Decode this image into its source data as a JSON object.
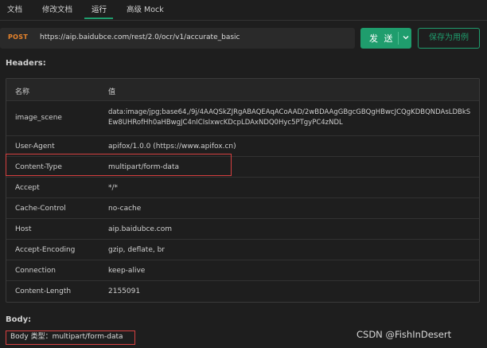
{
  "tabs": [
    {
      "label": "文档"
    },
    {
      "label": "修改文档"
    },
    {
      "label": "运行"
    },
    {
      "label": "高级 Mock"
    }
  ],
  "request": {
    "method": "POST",
    "url": "https://aip.baidubce.com/rest/2.0/ocr/v1/accurate_basic",
    "send_label": "发 送",
    "save_label": "保存为用例"
  },
  "headers": {
    "title": "Headers:",
    "col_name": "名称",
    "col_value": "值",
    "rows": [
      {
        "name": "image_scene",
        "value": "data:image/jpg;base64,/9j/4AAQSkZJRgABAQEAqACoAAD/2wBDAAgGBgcGBQgHBwcJCQgKDBQNDAsLDBkSEw8UHRofHh0aHBwgJC4nICIsIxwcKDcpLDAxNDQ0Hyc5PTgyPC4zNDL"
      },
      {
        "name": "User-Agent",
        "value": "apifox/1.0.0 (https://www.apifox.cn)"
      },
      {
        "name": "Content-Type",
        "value": "multipart/form-data"
      },
      {
        "name": "Accept",
        "value": "*/*"
      },
      {
        "name": "Cache-Control",
        "value": "no-cache"
      },
      {
        "name": "Host",
        "value": "aip.baidubce.com"
      },
      {
        "name": "Accept-Encoding",
        "value": "gzip, deflate, br"
      },
      {
        "name": "Connection",
        "value": "keep-alive"
      },
      {
        "name": "Content-Length",
        "value": "2155091"
      }
    ]
  },
  "body": {
    "title": "Body:",
    "type_label": "Body 类型：multipart/form-data"
  },
  "watermark": "CSDN @FishInDesert",
  "colors": {
    "accent": "#1f9d6d",
    "method": "#e8842c",
    "highlight": "#d64040",
    "background": "#1e1e1e"
  }
}
